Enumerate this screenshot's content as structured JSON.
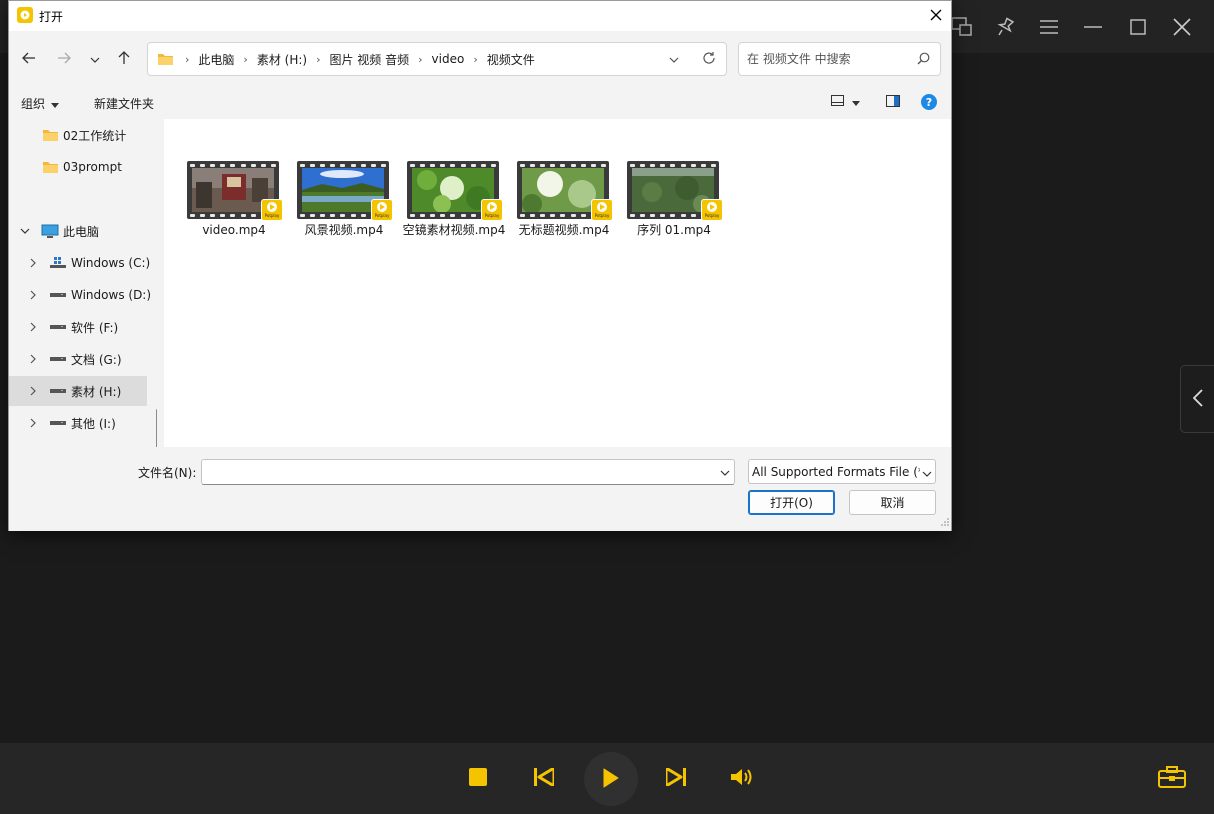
{
  "colors": {
    "accent": "#f5c400",
    "player_bg": "#1b1b1b",
    "dialog_bg": "#f3f3f3",
    "focus_blue": "#1a73c8"
  },
  "player": {
    "titlebar_icons": [
      "picture-in-picture-icon",
      "pin-icon",
      "menu-icon",
      "minimize-icon",
      "maximize-icon",
      "close-icon"
    ],
    "controls": [
      "stop-icon",
      "previous-icon",
      "play-icon",
      "next-icon",
      "volume-icon",
      "toolbox-icon"
    ]
  },
  "dialog": {
    "title": "打开",
    "breadcrumbs": [
      "此电脑",
      "素材 (H:)",
      "图片 视频 音频",
      "video",
      "视频文件"
    ],
    "search_placeholder": "在 视频文件 中搜索",
    "organize_label": "组织",
    "new_folder_label": "新建文件夹",
    "help_label": "?",
    "nav_tree": [
      {
        "label": "02工作统计",
        "icon": "folder-icon"
      },
      {
        "label": "03prompt",
        "icon": "folder-icon"
      },
      {
        "label": "此电脑",
        "icon": "computer-icon"
      },
      {
        "label": "Windows (C:)",
        "icon": "windows-drive-icon"
      },
      {
        "label": "Windows (D:)",
        "icon": "drive-icon"
      },
      {
        "label": "软件 (F:)",
        "icon": "drive-icon"
      },
      {
        "label": "文档 (G:)",
        "icon": "drive-icon"
      },
      {
        "label": "素材 (H:)",
        "icon": "drive-icon",
        "selected": true
      },
      {
        "label": "其他 (I:)",
        "icon": "drive-icon"
      }
    ],
    "files": [
      {
        "name": "video.mp4"
      },
      {
        "name": "风景视频.mp4"
      },
      {
        "name": "空镜素材视频.mp4"
      },
      {
        "name": "无标题视频.mp4"
      },
      {
        "name": "序列 01.mp4"
      }
    ],
    "badge_brand": "Potplay",
    "filename_label": "文件名(N):",
    "filename_value": "",
    "filetype_value": "All Supported Formats File (*.",
    "open_label": "打开(O)",
    "cancel_label": "取消"
  }
}
